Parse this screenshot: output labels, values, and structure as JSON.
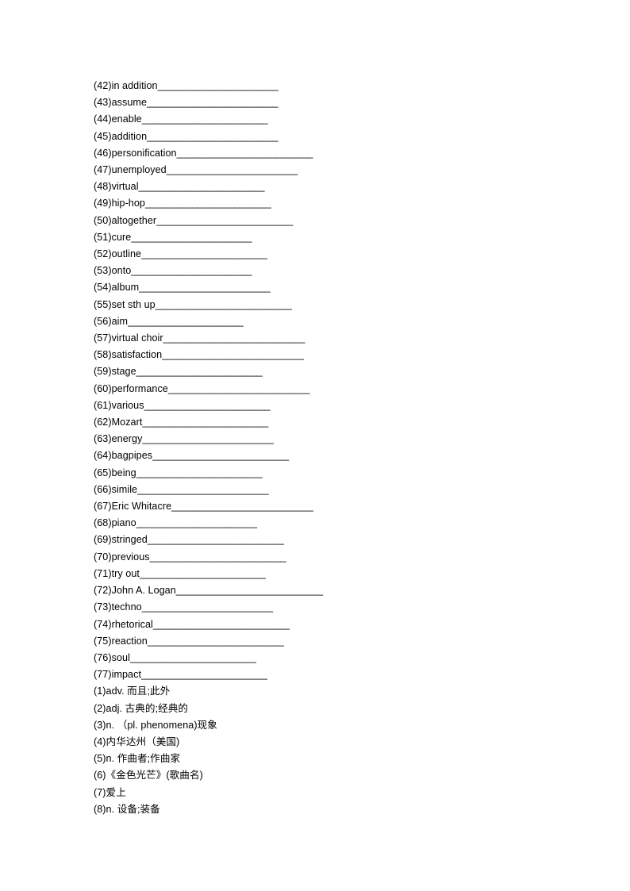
{
  "document": {
    "type": "vocabulary-worksheet",
    "blank_filler": "_________________________",
    "blank_fillers": {
      "short": "______________________",
      "medium": "_________________________",
      "long": "___________________________"
    }
  },
  "blank_entries": [
    {
      "number": "(42)",
      "term": "in addition",
      "blank": "_______________________"
    },
    {
      "number": "(43)",
      "term": "assume",
      "blank": "_________________________"
    },
    {
      "number": "(44)",
      "term": "enable",
      "blank": "________________________"
    },
    {
      "number": "(45)",
      "term": "addition",
      "blank": "_________________________"
    },
    {
      "number": "(46)",
      "term": "personification",
      "blank": "__________________________"
    },
    {
      "number": "(47)",
      "term": "unemployed",
      "blank": "_________________________"
    },
    {
      "number": "(48)",
      "term": "virtual",
      "blank": "________________________"
    },
    {
      "number": "(49)",
      "term": "hip-hop",
      "blank": "________________________"
    },
    {
      "number": "(50)",
      "term": "altogether",
      "blank": "__________________________"
    },
    {
      "number": "(51)",
      "term": "cure",
      "blank": "_______________________"
    },
    {
      "number": "(52)",
      "term": "outline",
      "blank": "________________________"
    },
    {
      "number": "(53)",
      "term": "onto",
      "blank": "_______________________"
    },
    {
      "number": "(54)",
      "term": "album",
      "blank": "_________________________"
    },
    {
      "number": "(55)",
      "term": "set sth up",
      "blank": "__________________________"
    },
    {
      "number": "(56)",
      "term": "aim",
      "blank": "______________________"
    },
    {
      "number": "(57)",
      "term": "virtual choir",
      "blank": "___________________________"
    },
    {
      "number": "(58)",
      "term": "satisfaction",
      "blank": "___________________________"
    },
    {
      "number": "(59)",
      "term": "stage",
      "blank": "________________________"
    },
    {
      "number": "(60)",
      "term": "performance",
      "blank": "___________________________"
    },
    {
      "number": "(61)",
      "term": "various",
      "blank": "________________________"
    },
    {
      "number": "(62)",
      "term": "Mozart",
      "blank": "________________________"
    },
    {
      "number": "(63)",
      "term": "energy",
      "blank": "_________________________"
    },
    {
      "number": "(64)",
      "term": "bagpipes",
      "blank": "__________________________"
    },
    {
      "number": "(65)",
      "term": "being",
      "blank": "________________________"
    },
    {
      "number": "(66)",
      "term": "simile",
      "blank": "_________________________"
    },
    {
      "number": "(67)",
      "term": "Eric Whitacre",
      "blank": "___________________________"
    },
    {
      "number": "(68)",
      "term": "piano",
      "blank": "_______________________"
    },
    {
      "number": "(69)",
      "term": "stringed",
      "blank": "__________________________"
    },
    {
      "number": "(70)",
      "term": "previous",
      "blank": "__________________________"
    },
    {
      "number": "(71)",
      "term": "try out",
      "blank": "________________________"
    },
    {
      "number": "(72)",
      "term": "John A. Logan",
      "blank": "____________________________"
    },
    {
      "number": "(73)",
      "term": "techno",
      "blank": "_________________________"
    },
    {
      "number": "(74)",
      "term": "rhetorical",
      "blank": "__________________________"
    },
    {
      "number": "(75)",
      "term": "reaction",
      "blank": "__________________________"
    },
    {
      "number": "(76)",
      "term": "soul",
      "blank": "________________________"
    },
    {
      "number": "(77)",
      "term": "impact",
      "blank": "________________________"
    }
  ],
  "gloss_entries": [
    {
      "number": "(1)",
      "text": "adv. 而且;此外"
    },
    {
      "number": "(2)",
      "text": "adj. 古典的;经典的"
    },
    {
      "number": "(3)",
      "text": "n. （pl. phenomena)现象"
    },
    {
      "number": "(4)",
      "text": "内华达州（美国)"
    },
    {
      "number": "(5)",
      "text": "n. 作曲者;作曲家"
    },
    {
      "number": "(6)",
      "text": "《金色光芒》(歌曲名)"
    },
    {
      "number": "(7)",
      "text": "爱上"
    },
    {
      "number": "(8)",
      "text": "n. 设备;装备"
    }
  ]
}
